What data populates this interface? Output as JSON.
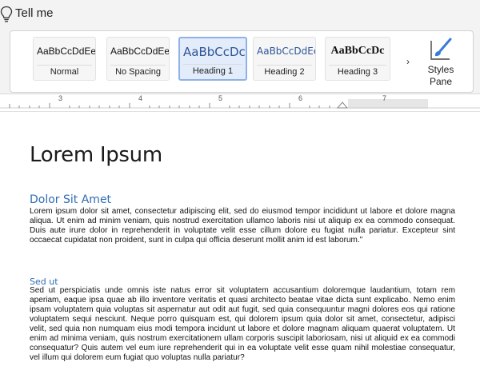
{
  "toolbar": {
    "tell_me_label": "Tell me",
    "tell_me_icon": "lightbulb-icon"
  },
  "styles_gallery": {
    "items": [
      {
        "sample": "AaBbCcDdEe",
        "name": "Normal",
        "selected": false
      },
      {
        "sample": "AaBbCcDdEe",
        "name": "No Spacing",
        "selected": false
      },
      {
        "sample": "AaBbCcDc",
        "name": "Heading 1",
        "selected": true
      },
      {
        "sample": "AaBbCcDdEe",
        "name": "Heading 2",
        "selected": false
      },
      {
        "sample": "AaBbCcDc",
        "name": "Heading 3",
        "selected": false
      }
    ],
    "more_glyph": "›",
    "styles_pane_label_line1": "Styles",
    "styles_pane_label_line2": "Pane",
    "styles_pane_icon": "paintbrush-icon"
  },
  "ruler": {
    "numbers": [
      "3",
      "4",
      "5",
      "6",
      "7"
    ]
  },
  "document": {
    "title": "Lorem Ipsum",
    "sections": [
      {
        "heading": "Dolor Sit Amet",
        "body": "Lorem ipsum dolor sit amet, consectetur adipiscing elit, sed do eiusmod tempor incididunt ut labore et dolore magna aliqua. Ut enim ad minim veniam, quis nostrud exercitation ullamco laboris nisi ut aliquip ex ea commodo consequat. Duis aute irure dolor in reprehenderit in voluptate velit esse cillum dolore eu fugiat nulla pariatur. Excepteur sint occaecat cupidatat non proident, sunt in culpa qui officia deserunt mollit anim id est laborum.\""
      },
      {
        "heading": "Sed ut",
        "body": "Sed ut perspiciatis unde omnis iste natus error sit voluptatem accusantium doloremque laudantium, totam rem aperiam, eaque ipsa quae ab illo inventore veritatis et quasi architecto beatae vitae dicta sunt explicabo. Nemo enim ipsam voluptatem quia voluptas sit aspernatur aut odit aut fugit, sed quia consequuntur magni dolores eos qui ratione voluptatem sequi nesciunt. Neque porro quisquam est, qui dolorem ipsum quia dolor sit amet, consectetur, adipisci velit, sed quia non numquam eius modi tempora incidunt ut labore et dolore magnam aliquam quaerat voluptatem. Ut enim ad minima veniam, quis nostrum exercitationem ullam corporis suscipit laboriosam, nisi ut aliquid ex ea commodi consequatur? Quis autem vel eum iure reprehenderit qui in ea voluptate velit esse quam nihil molestiae consequatur, vel illum qui dolorem eum fugiat quo voluptas nulla pariatur?"
      }
    ]
  },
  "colors": {
    "heading_blue": "#2e6db4",
    "selection_border": "#8fb1e8",
    "selection_fill": "#e3ecfa"
  }
}
